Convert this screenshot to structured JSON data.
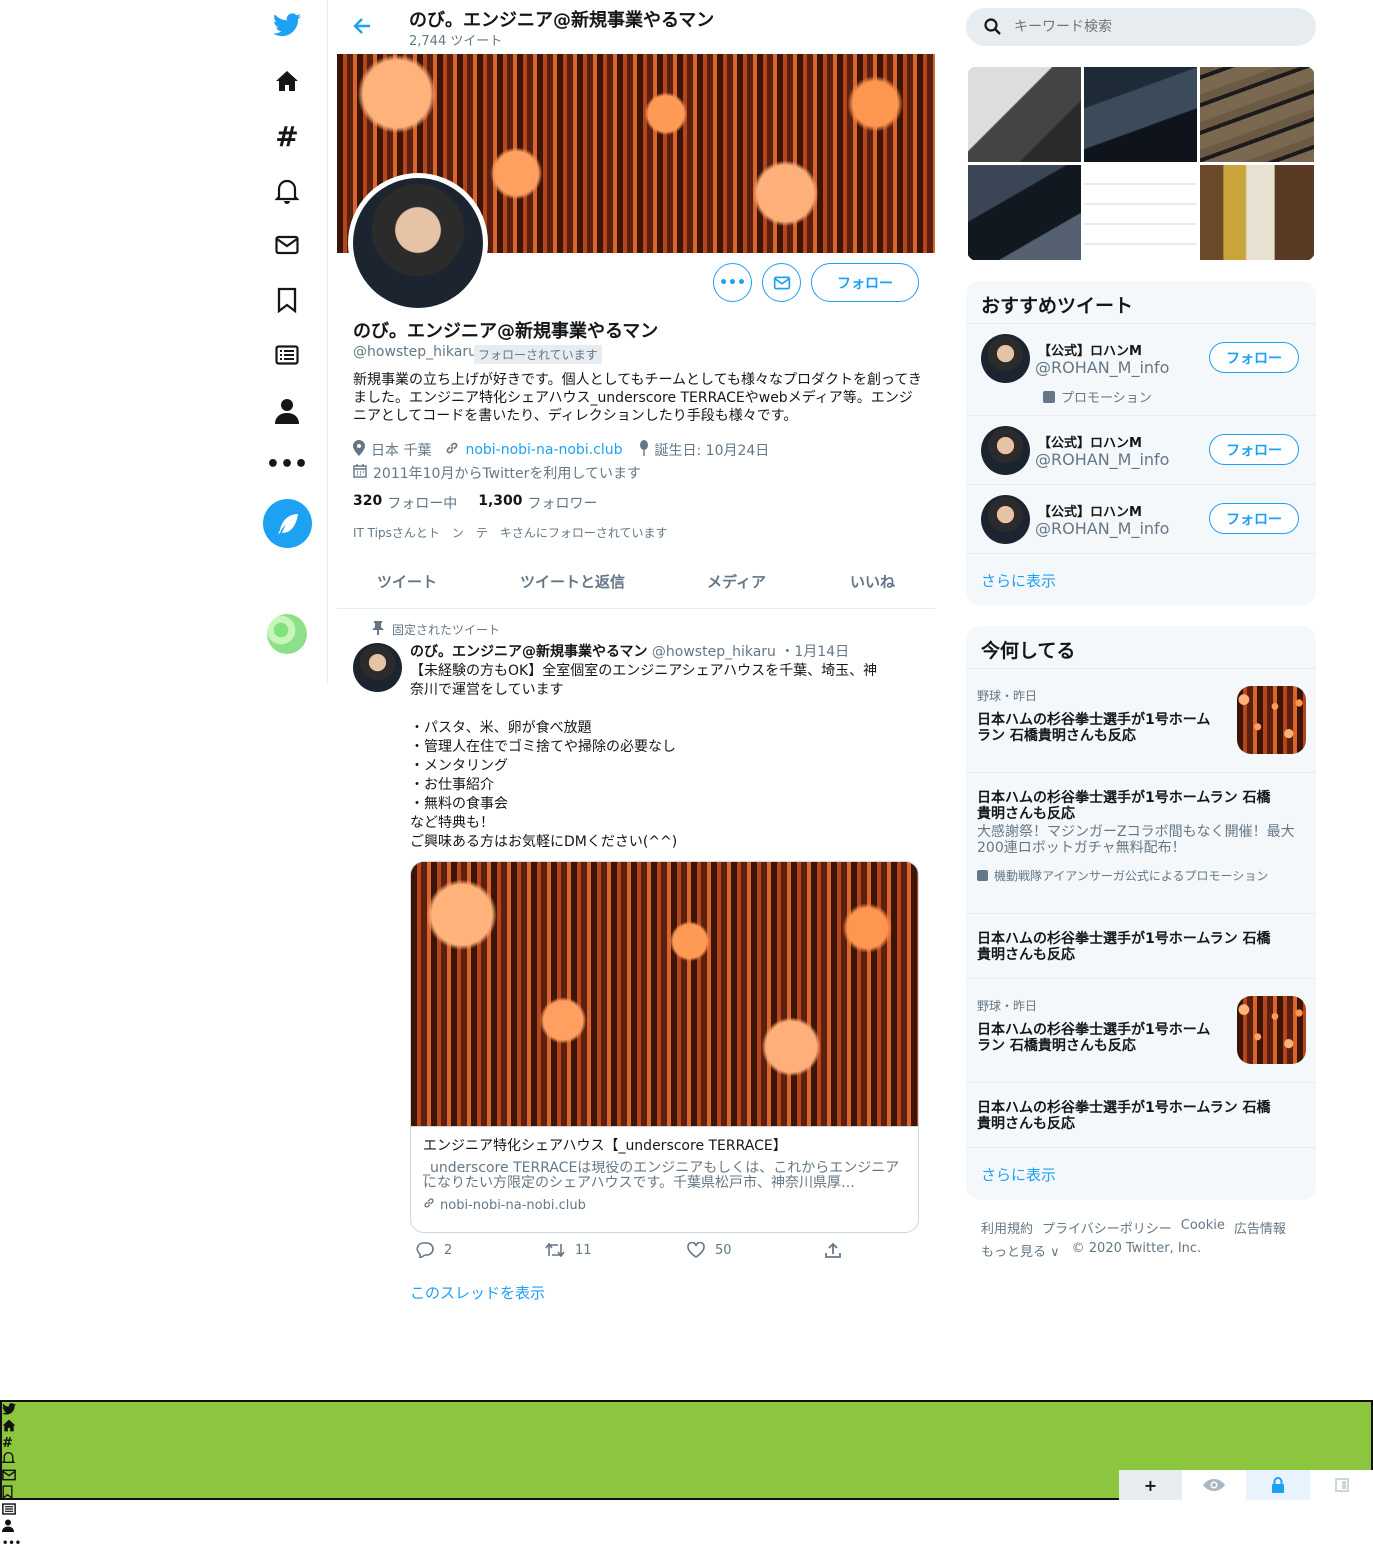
{
  "header": {
    "back_label": "",
    "name": "のび。エンジニア@新規事業やるマン",
    "tweet_count": "2,744 ツイート"
  },
  "profile": {
    "name": "のび。エンジニア@新規事業やるマン",
    "handle": "@howstep_hikaru",
    "follows_you": "フォローされています",
    "bio": "新規事業の立ち上げが好きです。個人としてもチームとしても様々なプロダクトを創ってきました。エンジニア特化シェアハウス_underscore TERRACEやwebメディア等。エンジニアとしてコードを書いたり、ディレクションしたり手段も様々です。",
    "location": "日本 千葉",
    "link": "nobi-nobi-na-nobi.club",
    "birthday": "誕生日: 10月24日",
    "joined": "2011年10月からTwitterを利用しています",
    "following_count": "320",
    "following_label": "フォロー中",
    "followers_count": "1,300",
    "followers_label": "フォロワー",
    "followed_by": "IT Tipsさんとト　ン　テ　キさんにフォローされています",
    "follow_button": "フォロー"
  },
  "tabs": [
    "ツイート",
    "ツイートと返信",
    "メディア",
    "いいね"
  ],
  "pinned_tweet": {
    "pinned_label": "固定されたツイート",
    "author": "のび。エンジニア@新規事業やるマン",
    "handle": "@howstep_hikaru",
    "date": "・1月14日",
    "lines": [
      "【未経験の方もOK】全室個室のエンジニアシェアハウスを千葉、埼玉、神",
      "奈川で運営をしています",
      "",
      "・パスタ、米、卵が食べ放題",
      "・管理人在住でゴミ捨てや掃除の必要なし",
      "・メンタリング",
      "・お仕事紹介",
      "・無料の食事会",
      "など特典も！",
      "ご興味ある方はお気軽にDMください(^^)"
    ],
    "card_title": "エンジニア特化シェアハウス【_underscore TERRACE】",
    "card_desc": "_underscore TERRACEは現役のエンジニアもしくは、これからエンジニアになりたい方限定のシェアハウスです。千葉県松戸市、神奈川県厚…",
    "card_link": "nobi-nobi-na-nobi.club",
    "replies": "2",
    "retweets": "11",
    "likes": "50",
    "show_thread": "このスレッドを表示"
  },
  "search": {
    "placeholder": "キーワード検索"
  },
  "who_to_follow": {
    "title": "おすすめツイート",
    "items": [
      {
        "name": "【公式】ロハンM",
        "handle": "@ROHAN_M_info",
        "promo": "プロモーション",
        "button": "フォロー"
      },
      {
        "name": "【公式】ロハンM",
        "handle": "@ROHAN_M_info",
        "button": "フォロー"
      },
      {
        "name": "【公式】ロハンM",
        "handle": "@ROHAN_M_info",
        "button": "フォロー"
      }
    ],
    "show_more": "さらに表示"
  },
  "trends": {
    "title": "今何してる",
    "items": [
      {
        "meta": "野球・昨日",
        "title": "日本ハムの杉谷拳士選手が1号ホームラン 石橋貴明さんも反応"
      },
      {
        "title": "日本ハムの杉谷拳士選手が1号ホームラン 石橋貴明さんも反応",
        "desc": "大感謝祭！マジンガーZコラボ間もなく開催！最大200連ロボットガチャ無料配布！",
        "promo": "機動戦隊アイアンサーガ公式によるプロモーション"
      },
      {
        "title": "日本ハムの杉谷拳士選手が1号ホームラン 石橋貴明さんも反応"
      },
      {
        "meta": "野球・昨日",
        "title": "日本ハムの杉谷拳士選手が1号ホームラン 石橋貴明さんも反応"
      },
      {
        "title": "日本ハムの杉谷拳士選手が1号ホームラン 石橋貴明さんも反応"
      }
    ],
    "show_more": "さらに表示"
  },
  "footer": {
    "links": [
      "利用規約",
      "プライバシーポリシー",
      "Cookie",
      "広告情報"
    ],
    "more": "もっと見る ∨",
    "copyright": "© 2020 Twitter, Inc."
  },
  "colors": {
    "accent": "#1da1f2",
    "banner": "#8cc63f"
  }
}
